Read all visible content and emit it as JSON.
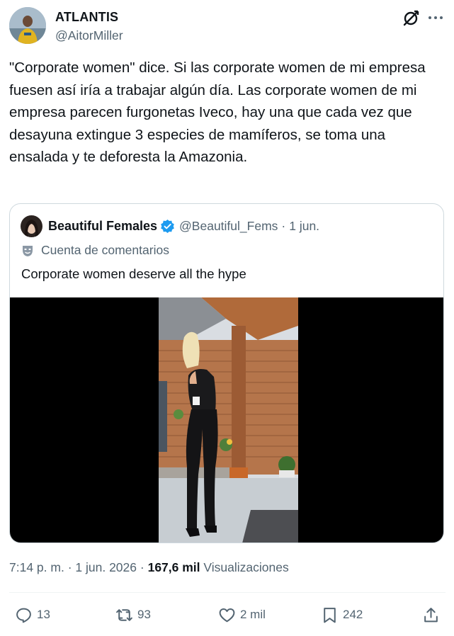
{
  "author": {
    "display_name": "ATLANTIS",
    "handle": "@AitorMiller",
    "avatar_icon": "profile-avatar"
  },
  "header_icons": [
    "grok-icon",
    "more-icon"
  ],
  "tweet": {
    "text": "\"Corporate women\" dice. Si las corporate women de mi empresa fuesen así iría a trabajar algún día. Las corporate women de mi empresa parecen furgonetas Iveco, hay una que cada vez que desayuna extingue 3 especies de mamíferos, se toma una ensalada y te deforesta la Amazonia."
  },
  "quote": {
    "display_name": "Beautiful Females",
    "handle": "@Beautiful_Fems",
    "date": "1 jun.",
    "separator": "·",
    "account_label": "Cuenta de comentarios",
    "text": "Corporate women deserve all the hype",
    "media": "photo-woman-in-black-jumpsuit-on-porch"
  },
  "meta": {
    "time": "7:14 p. m.",
    "date": "1 jun. 2026",
    "separator": "·",
    "views_count": "167,6 mil",
    "views_label": "Visualizaciones"
  },
  "actions": {
    "replies": "13",
    "retweets": "93",
    "likes": "2 mil",
    "bookmarks": "242"
  },
  "colors": {
    "text_primary": "#0f1419",
    "text_secondary": "#536471",
    "border": "#cfd9de",
    "verified_blue": "#1d9bf0"
  }
}
